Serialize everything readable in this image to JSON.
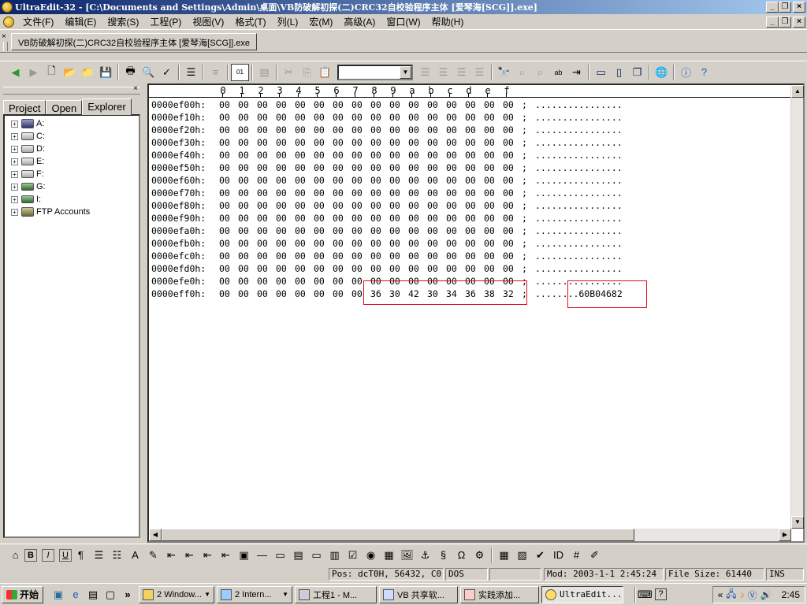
{
  "title_bar": {
    "title": "UltraEdit-32 - [C:\\Documents and Settings\\Admin\\桌面\\VB防破解初探(二)CRC32自校验程序主体 [爱琴海[SCG]].exe]",
    "minimize": "_",
    "restore": "❐",
    "close": "×"
  },
  "menu": {
    "items": [
      "文件(F)",
      "编辑(E)",
      "搜索(S)",
      "工程(P)",
      "视图(V)",
      "格式(T)",
      "列(L)",
      "宏(M)",
      "高级(A)",
      "窗口(W)",
      "帮助(H)"
    ]
  },
  "doc_tab": {
    "close": "×",
    "label": "VB防破解初探(二)CRC32自校验程序主体 [爱琴海[SCG]].exe"
  },
  "toolbar": {
    "font_select_value": ""
  },
  "left_panel": {
    "close": "×",
    "tabs": [
      "Project",
      "Open",
      "Explorer"
    ],
    "active_tab": "Explorer",
    "tree": [
      {
        "label": "A:",
        "icon": "floppy-drive-icon"
      },
      {
        "label": "C:",
        "icon": "hard-drive-icon"
      },
      {
        "label": "D:",
        "icon": "hard-drive-icon"
      },
      {
        "label": "E:",
        "icon": "hard-drive-icon"
      },
      {
        "label": "F:",
        "icon": "hard-drive-icon"
      },
      {
        "label": "G:",
        "icon": "network-drive-icon"
      },
      {
        "label": "I:",
        "icon": "network-drive-icon"
      },
      {
        "label": "FTP Accounts",
        "icon": "ftp-accounts-icon"
      }
    ]
  },
  "hex": {
    "ruler": [
      "0",
      "1",
      "2",
      "3",
      "4",
      "5",
      "6",
      "7",
      "8",
      "9",
      "a",
      "b",
      "c",
      "d",
      "e",
      "f"
    ],
    "rows": [
      {
        "addr": "0000ef00h:",
        "bytes": [
          "00",
          "00",
          "00",
          "00",
          "00",
          "00",
          "00",
          "00",
          "00",
          "00",
          "00",
          "00",
          "00",
          "00",
          "00",
          "00"
        ],
        "sep": ";",
        "ascii": "................"
      },
      {
        "addr": "0000ef10h:",
        "bytes": [
          "00",
          "00",
          "00",
          "00",
          "00",
          "00",
          "00",
          "00",
          "00",
          "00",
          "00",
          "00",
          "00",
          "00",
          "00",
          "00"
        ],
        "sep": ";",
        "ascii": "................"
      },
      {
        "addr": "0000ef20h:",
        "bytes": [
          "00",
          "00",
          "00",
          "00",
          "00",
          "00",
          "00",
          "00",
          "00",
          "00",
          "00",
          "00",
          "00",
          "00",
          "00",
          "00"
        ],
        "sep": ";",
        "ascii": "................"
      },
      {
        "addr": "0000ef30h:",
        "bytes": [
          "00",
          "00",
          "00",
          "00",
          "00",
          "00",
          "00",
          "00",
          "00",
          "00",
          "00",
          "00",
          "00",
          "00",
          "00",
          "00"
        ],
        "sep": ";",
        "ascii": "................"
      },
      {
        "addr": "0000ef40h:",
        "bytes": [
          "00",
          "00",
          "00",
          "00",
          "00",
          "00",
          "00",
          "00",
          "00",
          "00",
          "00",
          "00",
          "00",
          "00",
          "00",
          "00"
        ],
        "sep": ";",
        "ascii": "................"
      },
      {
        "addr": "0000ef50h:",
        "bytes": [
          "00",
          "00",
          "00",
          "00",
          "00",
          "00",
          "00",
          "00",
          "00",
          "00",
          "00",
          "00",
          "00",
          "00",
          "00",
          "00"
        ],
        "sep": ";",
        "ascii": "................"
      },
      {
        "addr": "0000ef60h:",
        "bytes": [
          "00",
          "00",
          "00",
          "00",
          "00",
          "00",
          "00",
          "00",
          "00",
          "00",
          "00",
          "00",
          "00",
          "00",
          "00",
          "00"
        ],
        "sep": ";",
        "ascii": "................"
      },
      {
        "addr": "0000ef70h:",
        "bytes": [
          "00",
          "00",
          "00",
          "00",
          "00",
          "00",
          "00",
          "00",
          "00",
          "00",
          "00",
          "00",
          "00",
          "00",
          "00",
          "00"
        ],
        "sep": ";",
        "ascii": "................"
      },
      {
        "addr": "0000ef80h:",
        "bytes": [
          "00",
          "00",
          "00",
          "00",
          "00",
          "00",
          "00",
          "00",
          "00",
          "00",
          "00",
          "00",
          "00",
          "00",
          "00",
          "00"
        ],
        "sep": ";",
        "ascii": "................"
      },
      {
        "addr": "0000ef90h:",
        "bytes": [
          "00",
          "00",
          "00",
          "00",
          "00",
          "00",
          "00",
          "00",
          "00",
          "00",
          "00",
          "00",
          "00",
          "00",
          "00",
          "00"
        ],
        "sep": ";",
        "ascii": "................"
      },
      {
        "addr": "0000efa0h:",
        "bytes": [
          "00",
          "00",
          "00",
          "00",
          "00",
          "00",
          "00",
          "00",
          "00",
          "00",
          "00",
          "00",
          "00",
          "00",
          "00",
          "00"
        ],
        "sep": ";",
        "ascii": "................"
      },
      {
        "addr": "0000efb0h:",
        "bytes": [
          "00",
          "00",
          "00",
          "00",
          "00",
          "00",
          "00",
          "00",
          "00",
          "00",
          "00",
          "00",
          "00",
          "00",
          "00",
          "00"
        ],
        "sep": ";",
        "ascii": "................"
      },
      {
        "addr": "0000efc0h:",
        "bytes": [
          "00",
          "00",
          "00",
          "00",
          "00",
          "00",
          "00",
          "00",
          "00",
          "00",
          "00",
          "00",
          "00",
          "00",
          "00",
          "00"
        ],
        "sep": ";",
        "ascii": "................"
      },
      {
        "addr": "0000efd0h:",
        "bytes": [
          "00",
          "00",
          "00",
          "00",
          "00",
          "00",
          "00",
          "00",
          "00",
          "00",
          "00",
          "00",
          "00",
          "00",
          "00",
          "00"
        ],
        "sep": ";",
        "ascii": "................"
      },
      {
        "addr": "0000efe0h:",
        "bytes": [
          "00",
          "00",
          "00",
          "00",
          "00",
          "00",
          "00",
          "00",
          "00",
          "00",
          "00",
          "00",
          "00",
          "00",
          "00",
          "00"
        ],
        "sep": ";",
        "ascii": "................"
      },
      {
        "addr": "0000eff0h:",
        "bytes": [
          "00",
          "00",
          "00",
          "00",
          "00",
          "00",
          "00",
          "00",
          "36",
          "30",
          "42",
          "30",
          "34",
          "36",
          "38",
          "32"
        ],
        "sep": ";",
        "ascii": "........60B04682"
      }
    ],
    "highlight_color": "#e0101c"
  },
  "status": {
    "position": "Pos: dcT0H, 56432, C0",
    "format": "DOS",
    "blank": "",
    "modified": "Mod: 2003-1-1 2:45:24",
    "file_size": "File Size: 61440",
    "mode": "INS"
  },
  "taskbar": {
    "start": "开始",
    "more": "»",
    "tasks": [
      {
        "label": "2 Window...",
        "icon": "folder-icon",
        "dropdown": true
      },
      {
        "label": "2 Intern...",
        "icon": "ie-icon",
        "dropdown": true
      },
      {
        "label": "工程1 - M...",
        "icon": "vb-icon",
        "dropdown": false
      },
      {
        "label": "VB 共享软...",
        "icon": "word-icon",
        "dropdown": false
      },
      {
        "label": "实践添加...",
        "icon": "tool-icon",
        "dropdown": false
      },
      {
        "label": "UltraEdit...",
        "icon": "ultraedit-icon",
        "dropdown": false,
        "active": true
      }
    ],
    "clock": "2:45",
    "tray_more": "«"
  }
}
